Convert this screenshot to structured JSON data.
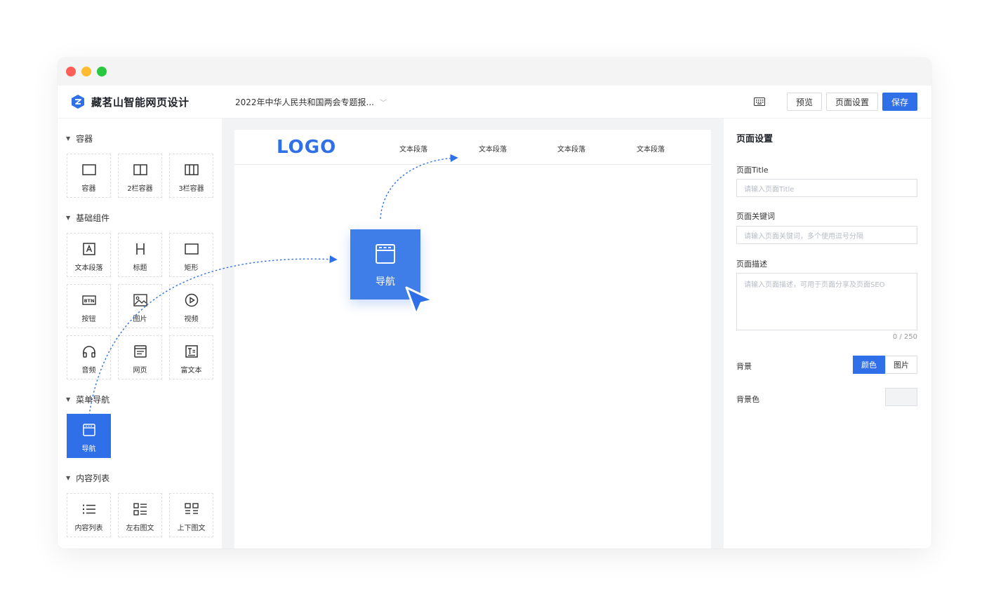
{
  "brand": {
    "name": "藏茗山智能网页设计"
  },
  "header": {
    "doc_title": "2022年中华人民共和国两会专题报...",
    "preview_label": "预览",
    "page_settings_label": "页面设置",
    "save_label": "保存"
  },
  "left_panel": {
    "groups": [
      {
        "title": "容器",
        "items": [
          "容器",
          "2栏容器",
          "3栏容器"
        ]
      },
      {
        "title": "基础组件",
        "items": [
          "文本段落",
          "标题",
          "矩形",
          "按钮",
          "图片",
          "视频",
          "音频",
          "网页",
          "富文本"
        ]
      },
      {
        "title": "菜单导航",
        "items": [
          "导航"
        ]
      },
      {
        "title": "内容列表",
        "items": [
          "内容列表",
          "左右图文",
          "上下图文"
        ]
      }
    ]
  },
  "canvas": {
    "logo": "LOGO",
    "nav_links": [
      "文本段落",
      "文本段落",
      "文本段落",
      "文本段落"
    ],
    "drag_item_label": "导航"
  },
  "right_panel": {
    "title": "页面设置",
    "title_label": "页面Title",
    "title_placeholder": "请输入页面Title",
    "keywords_label": "页面关键词",
    "keywords_placeholder": "请输入页面关键词，多个使用逗号分隔",
    "desc_label": "页面描述",
    "desc_placeholder": "请输入页面描述，可用于页面分享及页面SEO",
    "desc_count": "0 / 250",
    "bg_label": "背景",
    "bg_options": [
      "颜色",
      "图片"
    ],
    "bg_color_label": "背景色"
  },
  "colors": {
    "accent": "#2f6fe8",
    "panel_bg": "#f2f3f5"
  },
  "icons": [
    "brand-logo-icon",
    "keyboard-icon",
    "chevron-down-icon",
    "caret-down-icon",
    "cursor-icon"
  ]
}
